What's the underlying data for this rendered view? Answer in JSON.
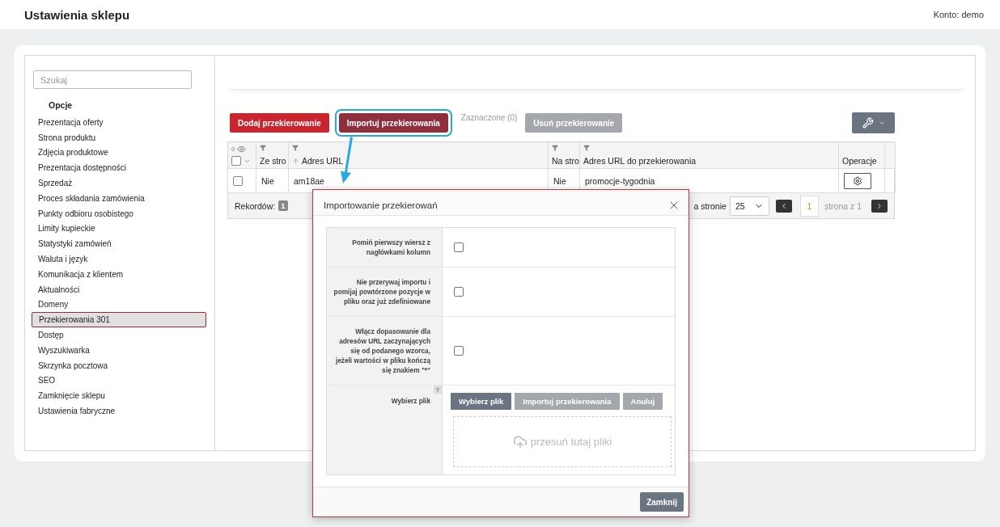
{
  "header": {
    "title": "Ustawienia sklepu",
    "account": "Konto: demo"
  },
  "sidebar": {
    "search": {
      "placeholder": "Szukaj"
    },
    "section": "Opcje",
    "items": [
      {
        "label": "Prezentacja oferty",
        "selected": false
      },
      {
        "label": "Strona produktu",
        "selected": false
      },
      {
        "label": "Zdjęcia produktowe",
        "selected": false
      },
      {
        "label": "Prezentacja dostępności",
        "selected": false
      },
      {
        "label": "Sprzedaż",
        "selected": false
      },
      {
        "label": "Proces składania zamówienia",
        "selected": false
      },
      {
        "label": "Punkty odbioru osobistego",
        "selected": false
      },
      {
        "label": "Limity kupieckie",
        "selected": false
      },
      {
        "label": "Statystyki zamówień",
        "selected": false
      },
      {
        "label": "Waluta i język",
        "selected": false
      },
      {
        "label": "Komunikacja z klientem",
        "selected": false
      },
      {
        "label": "Aktualności",
        "selected": false
      },
      {
        "label": "Domeny",
        "selected": false
      },
      {
        "label": "Przekierowania 301",
        "selected": true
      },
      {
        "label": "Dostęp",
        "selected": false
      },
      {
        "label": "Wyszukiwarka",
        "selected": false
      },
      {
        "label": "Skrzynka pocztowa",
        "selected": false
      },
      {
        "label": "SEO",
        "selected": false
      },
      {
        "label": "Zamknięcie sklepu",
        "selected": false
      },
      {
        "label": "Ustawienia fabryczne",
        "selected": false
      }
    ]
  },
  "toolbar": {
    "buttons": [
      {
        "label": "Dodaj przekierowanie",
        "kind": "primary",
        "highlighted": false
      },
      {
        "label": "Importuj przekierowania",
        "kind": "dark",
        "highlighted": true
      },
      {
        "label": "Zaznaczone (0)",
        "kind": "text",
        "highlighted": false
      },
      {
        "label": "Usuń przekierowanie",
        "kind": "disabled",
        "highlighted": false
      }
    ]
  },
  "table": {
    "hidden_count": "0",
    "select_all": {
      "checked": false
    },
    "columns": [
      {
        "label": "Ze stro",
        "filter": true,
        "sortable": false
      },
      {
        "label": "Adres URL",
        "filter": true,
        "sortable": true
      },
      {
        "label": "Na stro",
        "filter": true,
        "sortable": false
      },
      {
        "label": "Adres URL do przekierowania",
        "filter": true,
        "sortable": false
      },
      {
        "label": "Operacje",
        "filter": false,
        "sortable": false
      }
    ],
    "rows": [
      {
        "checked": false,
        "cells": [
          "Nie",
          "am18ae",
          "Nie",
          "promocje-tygodnia"
        ]
      }
    ],
    "footer": {
      "records_label": "Rekordów:",
      "records_count": "1",
      "per_page_label": "a stronie",
      "per_page": "25",
      "page": "1",
      "page_of": "strona z 1"
    }
  },
  "modal": {
    "title": "Importowanie przekierowań",
    "options": [
      {
        "label": "Pomiń pierwszy wiersz z nagłówkami kolumn",
        "checked": false
      },
      {
        "label": "Nie przerywaj importu i pomijaj powtórzone pozycje w pliku oraz już zdefiniowane",
        "checked": false
      },
      {
        "label": "Włącz dopasowanie dla adresów URL zaczynających się od podanego wzorca, jeżeli wartości w pliku kończą się znakiem \"*\"",
        "checked": false
      }
    ],
    "file": {
      "label": "Wybierz plik",
      "help": "?",
      "buttons": [
        {
          "label": "Wybierz plik",
          "kind": "dark"
        },
        {
          "label": "Importuj przekierowania",
          "kind": "disabled"
        },
        {
          "label": "Anuluj",
          "kind": "disabled"
        }
      ],
      "dropzone": "przesuń tutaj pliki"
    },
    "close_button": "Zamknij"
  }
}
